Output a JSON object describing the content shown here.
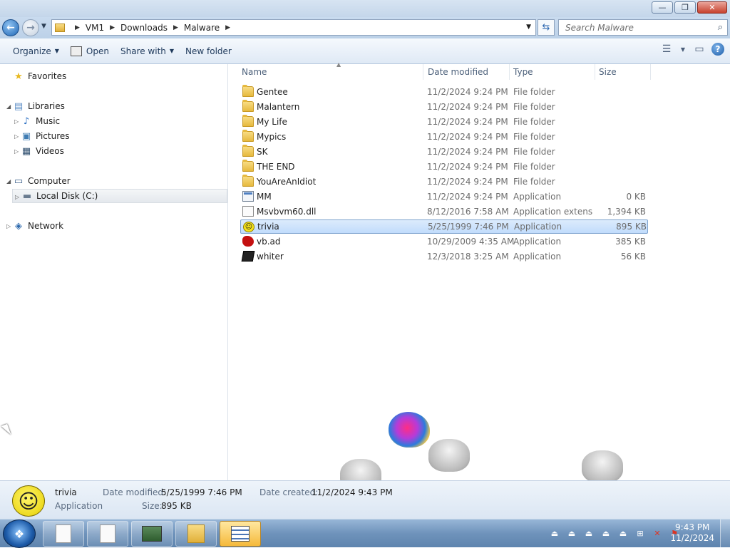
{
  "window": {
    "minimize_glyph": "—",
    "maximize_glyph": "❐",
    "close_glyph": "✕"
  },
  "address": {
    "crumbs": [
      "VM1",
      "Downloads",
      "Malware"
    ],
    "search_placeholder": "Search Malware"
  },
  "toolbar": {
    "organize": "Organize",
    "open": "Open",
    "share_with": "Share with",
    "new_folder": "New folder"
  },
  "nav": {
    "favorites": "Favorites",
    "libraries": "Libraries",
    "music": "Music",
    "pictures": "Pictures",
    "videos": "Videos",
    "computer": "Computer",
    "local_disk": "Local Disk (C:)",
    "network": "Network"
  },
  "columns": {
    "name": "Name",
    "date": "Date modified",
    "type": "Type",
    "size": "Size"
  },
  "files": [
    {
      "name": "Gentee",
      "date": "11/2/2024 9:24 PM",
      "type": "File folder",
      "size": "",
      "icon": "folder-icon"
    },
    {
      "name": "Malantern",
      "date": "11/2/2024 9:24 PM",
      "type": "File folder",
      "size": "",
      "icon": "folder-icon"
    },
    {
      "name": "My Life",
      "date": "11/2/2024 9:24 PM",
      "type": "File folder",
      "size": "",
      "icon": "folder-icon"
    },
    {
      "name": "Mypics",
      "date": "11/2/2024 9:24 PM",
      "type": "File folder",
      "size": "",
      "icon": "folder-icon"
    },
    {
      "name": "SK",
      "date": "11/2/2024 9:24 PM",
      "type": "File folder",
      "size": "",
      "icon": "folder-icon"
    },
    {
      "name": "THE END",
      "date": "11/2/2024 9:24 PM",
      "type": "File folder",
      "size": "",
      "icon": "folder-icon"
    },
    {
      "name": "YouAreAnIdiot",
      "date": "11/2/2024 9:24 PM",
      "type": "File folder",
      "size": "",
      "icon": "folder-icon"
    },
    {
      "name": "MM",
      "date": "11/2/2024 9:24 PM",
      "type": "Application",
      "size": "0 KB",
      "icon": "application-icon"
    },
    {
      "name": "Msvbvm60.dll",
      "date": "8/12/2016 7:58 AM",
      "type": "Application extens...",
      "size": "1,394 KB",
      "icon": "dll-icon"
    },
    {
      "name": "trivia",
      "date": "5/25/1999 7:46 PM",
      "type": "Application",
      "size": "895 KB",
      "icon": "smiley-icon"
    },
    {
      "name": "vb.ad",
      "date": "10/29/2009 4:35 AM",
      "type": "Application",
      "size": "385 KB",
      "icon": "red-blob-icon"
    },
    {
      "name": "whiter",
      "date": "12/3/2018 3:25 AM",
      "type": "Application",
      "size": "56 KB",
      "icon": "black-app-icon"
    }
  ],
  "selected_index": 9,
  "details": {
    "name": "trivia",
    "kind": "Application",
    "date_modified_label": "Date modified:",
    "date_modified": "5/25/1999 7:46 PM",
    "size_label": "Size:",
    "size": "895 KB",
    "date_created_label": "Date created:",
    "date_created": "11/2/2024 9:43 PM"
  },
  "clock": {
    "time": "9:43 PM",
    "date": "11/2/2024"
  },
  "colors": {
    "selection": "#c1dcfc",
    "selection_border": "#7da2ce",
    "taskbar": "#6f93bb",
    "link_text": "#1e395b"
  }
}
